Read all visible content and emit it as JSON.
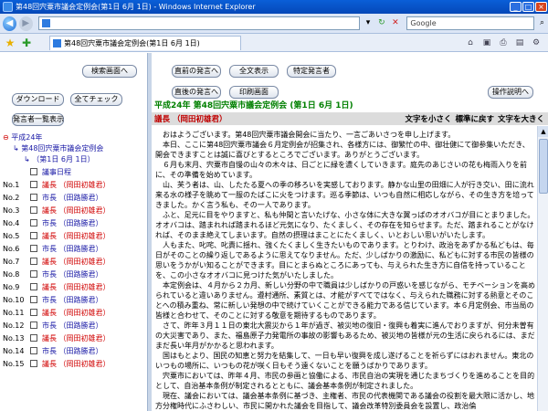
{
  "window": {
    "title": "第48回宍粟市議会定例会(第1日 6月 1日) - Windows Internet Explorer",
    "tab_title": "第48回宍粟市議会定例会(第1日 6月 1日)",
    "search_placeholder": "Google"
  },
  "left": {
    "buttons": {
      "search_screen": "検索画面へ",
      "download": "ダウンロード",
      "check_all": "全てチェック",
      "speaker_list": "発言者一覧表示"
    },
    "tree": {
      "year": "平成24年",
      "session": "第48回宍粟市議会定例会",
      "day": "（第1日 6月 1日）",
      "agenda": "議事日程"
    },
    "items": [
      {
        "no": "No.1",
        "label": "議長 （岡田初雄君）"
      },
      {
        "no": "No.2",
        "label": "市長 （田路勝君）"
      },
      {
        "no": "No.3",
        "label": "議長 （岡田初雄君）"
      },
      {
        "no": "No.4",
        "label": "市長 （田路勝君）"
      },
      {
        "no": "No.5",
        "label": "議長 （岡田初雄君）"
      },
      {
        "no": "No.6",
        "label": "市長 （田路勝君）"
      },
      {
        "no": "No.7",
        "label": "議長 （岡田初雄君）"
      },
      {
        "no": "No.8",
        "label": "市長 （田路勝君）"
      },
      {
        "no": "No.9",
        "label": "議長 （岡田初雄君）"
      },
      {
        "no": "No.10",
        "label": "市長 （田路勝君）"
      },
      {
        "no": "No.11",
        "label": "議長 （岡田初雄君）"
      },
      {
        "no": "No.12",
        "label": "市長 （田路勝君）"
      },
      {
        "no": "No.13",
        "label": "議長 （岡田初雄君）"
      },
      {
        "no": "No.14",
        "label": "市長 （田路勝君）"
      },
      {
        "no": "No.15",
        "label": "議長 （岡田初雄君）"
      }
    ]
  },
  "right": {
    "buttons": {
      "prev": "直前の発言へ",
      "all": "全文表示",
      "specific": "特定発言者",
      "next": "直後の発言へ",
      "print": "印刷画面",
      "help": "操作説明へ"
    },
    "session_title": "平成24年 第48回宍粟市議会定例会 (第1日 6月 1日)",
    "speaker": "議長 （岡田初雄君）",
    "font_controls": {
      "smaller": "文字を小さく",
      "reset": "標準に戻す",
      "larger": "文字を大きく"
    },
    "paragraphs": [
      "おはようございます。第48回宍粟市議会開会に当たり、一言ごあいさつを申し上げます。",
      "本日、ここに第48回宍粟市議会６月定例会が招集され、各様方には、御繁忙の中、御壮健にて御参集いただき、開会できますことは誠に喜びとするところでございます。ありがとうございます。",
      "６月も末月、宍粟市自慢の山々の木々は、日ごとに緑を濃くしていきます。庭先のあじさいの花も梅雨入りを前に、その準備を始めています。",
      "山、芙う者は、山、したたる夏への季の移ろいを実感しております。静かな山里の田畑に人が行き交い、田に流れ来る水の様子を眺めて一服のたばこに火をつけます。巡る季節は、いつも自然に相応しながら、その生き方を培ってきました。かく言う私も、その一人であります。",
      "ふと、足元に目をやりますと、私も仲間と言いたげな、小さな体に大きな翼っぱのオオバコが目にとまりました。オオバコは、踏まれれば踏まれるほど元気になり、たくましく、その存在を知らせます。ただ、踏まれることがなければ、そのまま絶えてしまいます。自然の摂理はまことにたくましく、いとおしい思いがいたします。",
      "人もまた、叱咤、叱責に揺れ、強くたくましく生きたいものであります。とりわけ、政治をあずかる私どもは、毎日がそのことの繰り返しであるように思えてなりません。ただ、少しばかりの激励に、私どもに対する市民の皆様の思いをうかがい知ることができます。目にとまらぬところにあっても、与えられた生き方に自信を持っていることを、この小さなオオバコに見つけた気がいたしました。",
      "本定例会は、４月から２カ月、新しい分野の中で職員は少しばかりの戸惑いを感じながら、モチベーションを高められていると違いありません。遵村通所、素質とは、才能がすべてではなく、与えられた職務に対する熱意とそのことへの積み重ね、常に新しい発想の中で続けていくことができる能力である信じています。本６月定例会、市当局の皆様と合わせて、そのことに対する敬意を期待するものであります。",
      "さて、昨年３月１１日の東北大震災から１年が過ぎ、被災地の復旧・復興も着実に進んでおりますが、何分未曽有の大災害であり、また、福島原子力発電所の事故の影響もあるため、被災地の皆様が元の生活に戻られるには、まだまだ長い年月がかかると思われます。",
      "国はもとより、国民の知恵と努力を結集して、一日も早い復興を成し遂げることを祈らずにはおれません。東北のいつもの場所に、いつもの花が咲く日もそう遠くないことを願うばかりであります。",
      "宍粟市においては、昨年４月、市民の参画と協働による、市民自治の実現を通じたまちづくりを進めることを目的として、自治基本条例が制定されるとともに、議会基本条例が制定されました。",
      "現在、議会においては、議会基本条例に基づき、主権者、市民の代表機関である議会の役割を最大限に活かし、地方分権時代にふさわしい、市民に開かれた議会を目指して、議会改革特別委員会を設置し、政治倫"
    ]
  }
}
